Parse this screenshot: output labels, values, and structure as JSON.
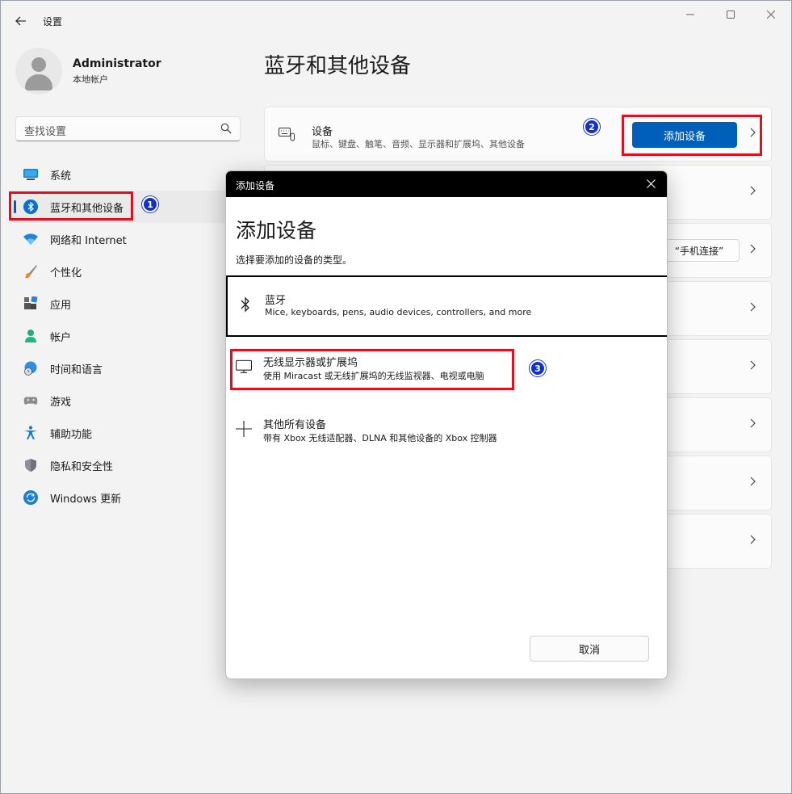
{
  "app": {
    "title": "设置",
    "back_icon": "back-arrow-icon",
    "window_controls": [
      "minimize-icon",
      "maximize-icon",
      "close-icon"
    ]
  },
  "profile": {
    "name": "Administrator",
    "account_type": "本地帐户"
  },
  "search": {
    "placeholder": "查找设置"
  },
  "sidebar": {
    "items": [
      {
        "label": "系统",
        "icon": "system-icon",
        "active": false
      },
      {
        "label": "蓝牙和其他设备",
        "icon": "bluetooth-icon",
        "active": true
      },
      {
        "label": "网络和 Internet",
        "icon": "wifi-icon",
        "active": false
      },
      {
        "label": "个性化",
        "icon": "brush-icon",
        "active": false
      },
      {
        "label": "应用",
        "icon": "apps-icon",
        "active": false
      },
      {
        "label": "帐户",
        "icon": "account-icon",
        "active": false
      },
      {
        "label": "时间和语言",
        "icon": "globe-clock-icon",
        "active": false
      },
      {
        "label": "游戏",
        "icon": "gamepad-icon",
        "active": false
      },
      {
        "label": "辅助功能",
        "icon": "accessibility-icon",
        "active": false
      },
      {
        "label": "隐私和安全性",
        "icon": "shield-icon",
        "active": false
      },
      {
        "label": "Windows 更新",
        "icon": "update-icon",
        "active": false
      }
    ]
  },
  "main": {
    "title": "蓝牙和其他设备",
    "devices_card": {
      "title": "设备",
      "subtitle": "鼠标、键盘、触笔、音频、显示器和扩展坞、其他设备",
      "add_button": "添加设备"
    },
    "phone_button_label": "“手机连接”"
  },
  "dialog": {
    "titlebar": "添加设备",
    "heading": "添加设备",
    "subtitle": "选择要添加的设备的类型。",
    "options": [
      {
        "title": "蓝牙",
        "description": "Mice, keyboards, pens, audio devices, controllers, and more",
        "icon": "bluetooth-icon"
      },
      {
        "title": "无线显示器或扩展坞",
        "description": "使用 Miracast 或无线扩展坞的无线监视器、电视或电脑",
        "icon": "monitor-icon"
      },
      {
        "title": "其他所有设备",
        "description": "带有 Xbox 无线适配器、DLNA 和其他设备的 Xbox 控制器",
        "icon": "plus-icon"
      }
    ],
    "cancel_button": "取消"
  },
  "annotations": {
    "badges": [
      "1",
      "2",
      "3"
    ],
    "highlight_color": "#e01020",
    "badge_color": "#1131c9"
  },
  "colors": {
    "accent": "#005fb8",
    "background": "#f3f3f3"
  }
}
